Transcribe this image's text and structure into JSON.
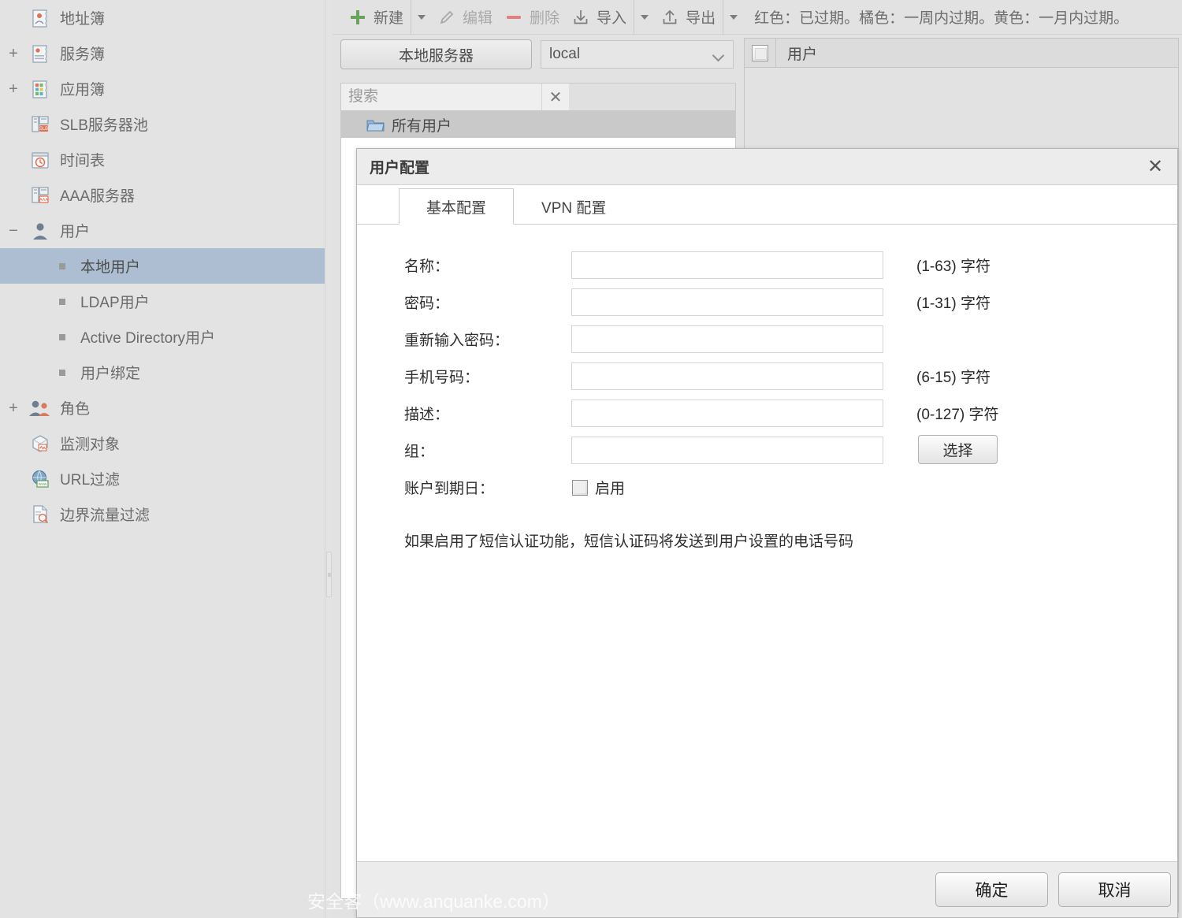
{
  "sidebar": {
    "items": [
      {
        "label": "地址簿",
        "icon": "address-book-icon",
        "expander": "",
        "level": 1,
        "selected": false
      },
      {
        "label": "服务簿",
        "icon": "service-book-icon",
        "expander": "+",
        "level": 1,
        "selected": false
      },
      {
        "label": "应用簿",
        "icon": "app-book-icon",
        "expander": "+",
        "level": 1,
        "selected": false
      },
      {
        "label": "SLB服务器池",
        "icon": "slb-server-icon",
        "expander": "",
        "level": 1,
        "selected": false
      },
      {
        "label": "时间表",
        "icon": "schedule-icon",
        "expander": "",
        "level": 1,
        "selected": false
      },
      {
        "label": "AAA服务器",
        "icon": "aaa-server-icon",
        "expander": "",
        "level": 1,
        "selected": false
      },
      {
        "label": "用户",
        "icon": "user-icon",
        "expander": "−",
        "level": 1,
        "selected": false
      },
      {
        "label": "本地用户",
        "icon": "bullet",
        "expander": "",
        "level": 2,
        "selected": true
      },
      {
        "label": "LDAP用户",
        "icon": "bullet",
        "expander": "",
        "level": 2,
        "selected": false
      },
      {
        "label": "Active Directory用户",
        "icon": "bullet",
        "expander": "",
        "level": 2,
        "selected": false
      },
      {
        "label": "用户绑定",
        "icon": "bullet",
        "expander": "",
        "level": 2,
        "selected": false
      },
      {
        "label": "角色",
        "icon": "role-icon",
        "expander": "+",
        "level": 1,
        "selected": false
      },
      {
        "label": "监测对象",
        "icon": "monitor-object-icon",
        "expander": "",
        "level": 1,
        "selected": false
      },
      {
        "label": "URL过滤",
        "icon": "url-filter-icon",
        "expander": "",
        "level": 1,
        "selected": false
      },
      {
        "label": "边界流量过滤",
        "icon": "edge-traffic-icon",
        "expander": "",
        "level": 1,
        "selected": false
      }
    ]
  },
  "toolbar": {
    "new_label": "新建",
    "edit_label": "编辑",
    "delete_label": "删除",
    "import_label": "导入",
    "export_label": "导出",
    "legend": "红色：已过期。橘色：一周内过期。黄色：一月内过期。",
    "new_icon": "plus-icon",
    "edit_icon": "pencil-icon",
    "delete_icon": "minus-icon",
    "import_icon": "download-arrow-icon",
    "export_icon": "upload-arrow-icon",
    "caret_icon": "chevron-down-icon",
    "colors": {
      "new": "#67a35a",
      "delete": "#e08080"
    }
  },
  "listpane": {
    "local_server_button": "本地服务器",
    "server_selected": "local",
    "search_placeholder": "搜索",
    "search_value": "",
    "clear_icon": "close-icon",
    "tree": [
      {
        "label": "所有用户",
        "icon": "folder-icon",
        "selected": true
      }
    ]
  },
  "tablepane": {
    "select_all_icon": "checkbox-icon",
    "column_user": "用户",
    "rows": []
  },
  "dialog": {
    "title": "用户配置",
    "close_icon": "close-icon",
    "tabs": [
      {
        "label": "基本配置",
        "active": true
      },
      {
        "label": "VPN 配置",
        "active": false
      }
    ],
    "fields": [
      {
        "label": "名称：",
        "value": "",
        "hint": "(1-63) 字符",
        "name": "name"
      },
      {
        "label": "密码：",
        "value": "",
        "hint": "(1-31) 字符",
        "name": "password"
      },
      {
        "label": "重新输入密码：",
        "value": "",
        "hint": "",
        "name": "confirm-password"
      },
      {
        "label": "手机号码：",
        "value": "",
        "hint": "(6-15) 字符",
        "name": "phone"
      },
      {
        "label": "描述：",
        "value": "",
        "hint": "(0-127) 字符",
        "name": "description"
      },
      {
        "label": "组：",
        "value": "",
        "hint": "",
        "name": "group"
      }
    ],
    "select_button": "选择",
    "expiry_label": "账户到期日：",
    "expiry_checkbox_label": "启用",
    "expiry_checked": false,
    "note": "如果启用了短信认证功能，短信认证码将发送到用户设置的电话号码",
    "ok_button": "确定",
    "cancel_button": "取消"
  },
  "watermark": "安全客（www.anquanke.com）"
}
